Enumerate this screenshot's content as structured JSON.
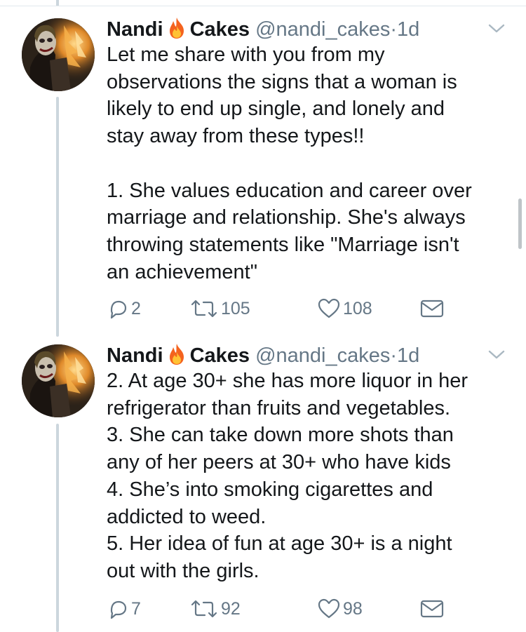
{
  "tweets": [
    {
      "author_name_first": "Nandi",
      "author_name_emoji": "fire-emoji",
      "author_name_last": "Cakes",
      "handle": "@nandi_cakes",
      "separator": "·",
      "time": "1d",
      "body_lines": [
        "Let me share with you from my",
        "observations the signs that a woman is",
        "likely to end up single, and lonely and",
        "stay away from these types!!",
        "",
        "1. She values education and career over",
        "marriage and relationship. She's always",
        "throwing statements like \"Marriage isn't",
        "an achievement\""
      ],
      "replies": "2",
      "retweets": "105",
      "likes": "108"
    },
    {
      "author_name_first": "Nandi",
      "author_name_emoji": "fire-emoji",
      "author_name_last": "Cakes",
      "handle": "@nandi_cakes",
      "separator": "·",
      "time": "1d",
      "body_lines": [
        "2. At age 30+ she has more liquor in her",
        "refrigerator than fruits and vegetables.",
        "3. She can take down more shots than",
        "any of her peers at 30+ who have kids",
        "4. She’s into smoking cigarettes and",
        "addicted to weed.",
        "5. Her idea of fun at age 30+ is a night",
        "out with the girls."
      ],
      "replies": "7",
      "retweets": "92",
      "likes": "98"
    }
  ],
  "colors": {
    "text": "#14171a",
    "secondary": "#657786",
    "thread_line": "#ccd6dd",
    "divider": "#e1e8ed"
  }
}
